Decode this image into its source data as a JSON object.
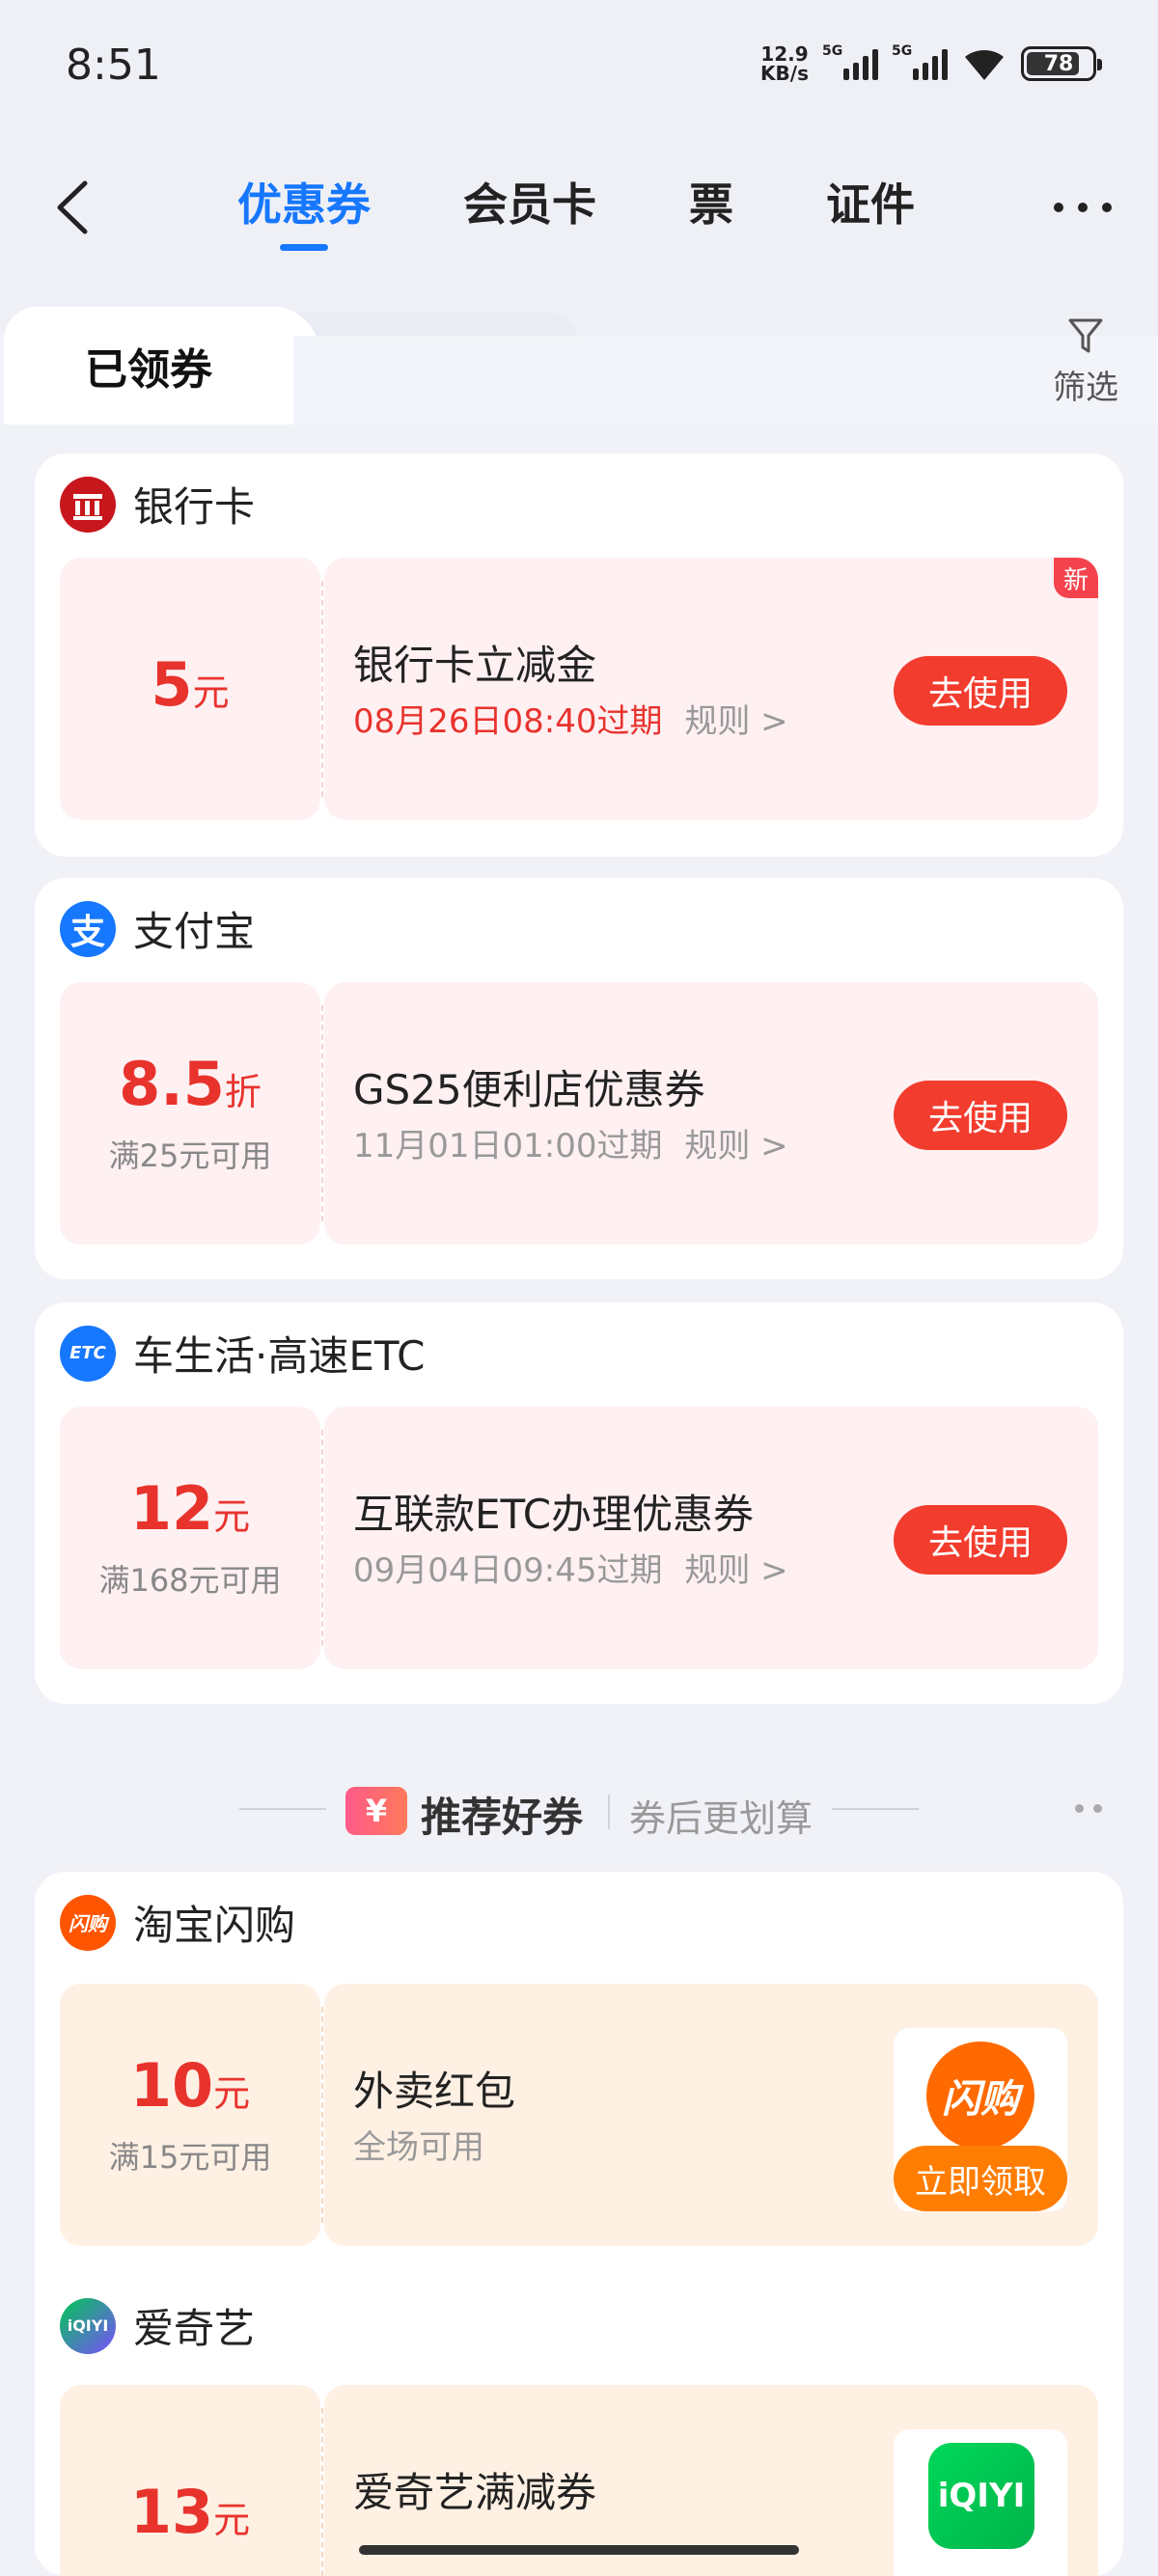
{
  "status_bar": {
    "time": "8:51",
    "net_speed_value": "12.9",
    "net_speed_unit": "KB/s",
    "sim1": "5G",
    "sim2": "5G",
    "battery": "78"
  },
  "nav": {
    "tabs": [
      {
        "label": "优惠券",
        "active": true
      },
      {
        "label": "会员卡",
        "active": false
      },
      {
        "label": "票",
        "active": false
      },
      {
        "label": "证件",
        "active": false
      }
    ]
  },
  "subtabs": {
    "received": "已领券",
    "recommended": "推荐好券",
    "filter": "筛选"
  },
  "my_coupons": [
    {
      "brand": "银行卡",
      "amount": "5",
      "unit": "元",
      "condition": "",
      "title": "银行卡立减金",
      "expire": "08月26日08:40过期",
      "rule": "规则 >",
      "button": "去使用",
      "badge": "新"
    },
    {
      "brand": "支付宝",
      "amount": "8.5",
      "unit": "折",
      "condition": "满25元可用",
      "title": "GS25便利店优惠券",
      "expire": "11月01日01:00过期",
      "rule": "规则 >",
      "button": "去使用"
    },
    {
      "brand": "车生活·高速ETC",
      "amount": "12",
      "unit": "元",
      "condition": "满168元可用",
      "title": "互联款ETC办理优惠券",
      "expire": "09月04日09:45过期",
      "rule": "规则 >",
      "button": "去使用"
    }
  ],
  "recommend_header": {
    "badge": "¥",
    "title": "推荐好券",
    "subtitle": "券后更划算"
  },
  "recommend": [
    {
      "brand": "淘宝闪购",
      "amount": "10",
      "unit": "元",
      "condition": "满15元可用",
      "title": "外卖红包",
      "subtitle": "全场可用",
      "logo_text": "闪购",
      "button": "立即领取"
    },
    {
      "brand": "爱奇艺",
      "amount": "13",
      "unit": "元",
      "title": "爱奇艺满减券",
      "logo_text": "iQIYI"
    }
  ],
  "icons": {
    "brand_icons": [
      "bank-card-icon",
      "alipay-icon",
      "etc-icon",
      "taobao-shangou-icon",
      "iqiyi-icon"
    ],
    "accent": "#1677ff",
    "coupon_red": "#e8332d",
    "button_red": "#f23c2e",
    "button_orange": "#ff7d00"
  }
}
